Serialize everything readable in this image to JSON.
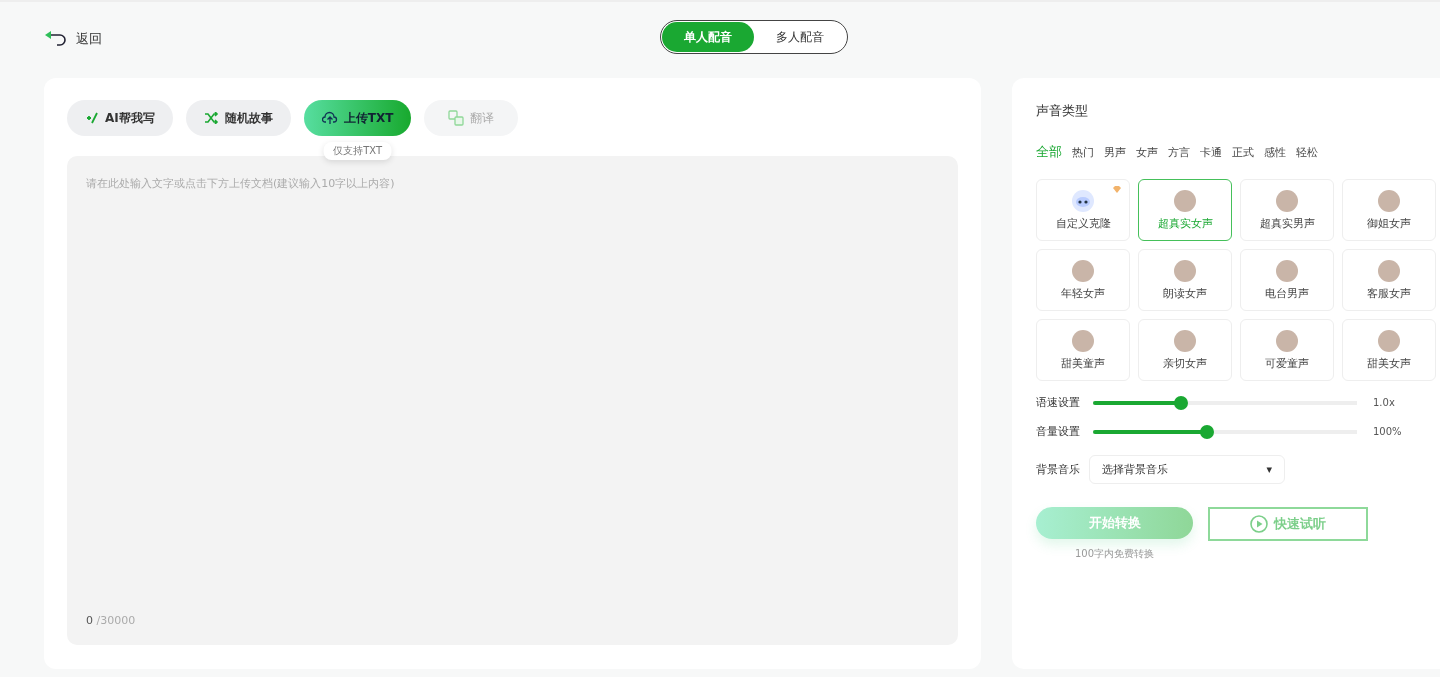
{
  "back": {
    "label": "返回"
  },
  "mode_tabs": [
    {
      "label": "单人配音",
      "selected": true
    },
    {
      "label": "多人配音",
      "selected": false
    }
  ],
  "tools": [
    {
      "kind": "write",
      "label": "AI帮我写",
      "disabled": false
    },
    {
      "kind": "shuffle",
      "label": "随机故事",
      "disabled": false
    },
    {
      "kind": "upload",
      "label": "上传TXT",
      "disabled": false,
      "tooltip": "仅支持TXT"
    },
    {
      "kind": "translate",
      "label": "翻译",
      "disabled": true
    }
  ],
  "editor": {
    "placeholder": "请在此处输入文字或点击下方上传文档(建议输入10字以上内容)",
    "count": "0",
    "limit": "/30000"
  },
  "voice_panel": {
    "title": "声音类型",
    "categories": [
      {
        "label": "全部",
        "selected": true
      },
      {
        "label": "热门",
        "selected": false
      },
      {
        "label": "男声",
        "selected": false
      },
      {
        "label": "女声",
        "selected": false
      },
      {
        "label": "方言",
        "selected": false
      },
      {
        "label": "卡通",
        "selected": false
      },
      {
        "label": "正式",
        "selected": false
      },
      {
        "label": "感性",
        "selected": false
      },
      {
        "label": "轻松",
        "selected": false
      }
    ],
    "voices": [
      {
        "kind": "robot",
        "name": "自定义克隆",
        "selected": false,
        "premium": true
      },
      {
        "kind": "photo",
        "name": "超真实女声",
        "selected": true,
        "premium": false
      },
      {
        "kind": "photo",
        "name": "超真实男声",
        "selected": false,
        "premium": false
      },
      {
        "kind": "photo",
        "name": "御姐女声",
        "selected": false,
        "premium": false
      },
      {
        "kind": "photo",
        "name": "年轻女声",
        "selected": false,
        "premium": false
      },
      {
        "kind": "photo",
        "name": "朗读女声",
        "selected": false,
        "premium": false
      },
      {
        "kind": "photo",
        "name": "电台男声",
        "selected": false,
        "premium": false
      },
      {
        "kind": "photo",
        "name": "客服女声",
        "selected": false,
        "premium": false
      },
      {
        "kind": "photo",
        "name": "甜美童声",
        "selected": false,
        "premium": false
      },
      {
        "kind": "photo",
        "name": "亲切女声",
        "selected": false,
        "premium": false
      },
      {
        "kind": "photo",
        "name": "可爱童声",
        "selected": false,
        "premium": false
      },
      {
        "kind": "photo",
        "name": "甜美女声",
        "selected": false,
        "premium": false
      }
    ],
    "sliders": [
      {
        "label": "语速设置",
        "level": 0.333,
        "reading": "1.0x"
      },
      {
        "label": "音量设置",
        "level": 0.43,
        "reading": "100%"
      }
    ],
    "music": {
      "label": "背景音乐",
      "value": "选择背景音乐",
      "caret": "▾"
    },
    "convert": {
      "label": "开始转换",
      "disabled": true,
      "note": "100字内免费转换"
    },
    "preview": {
      "label": "快速试听"
    }
  }
}
